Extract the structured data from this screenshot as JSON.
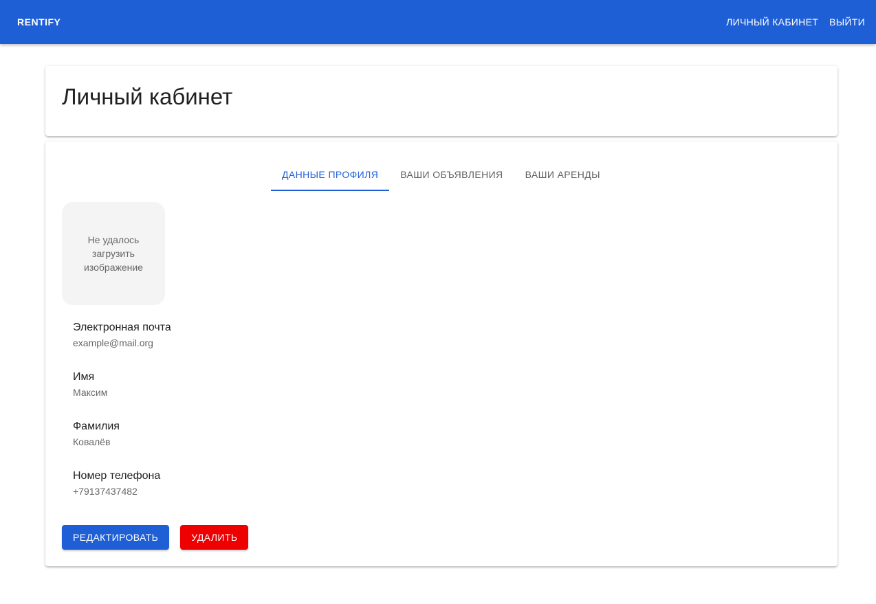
{
  "appbar": {
    "brand": "RENTIFY",
    "links": {
      "account": "ЛИЧНЫЙ КАБИНЕТ",
      "logout": "ВЫЙТИ"
    }
  },
  "page": {
    "title": "Личный кабинет"
  },
  "tabs": {
    "profile": "ДАННЫЕ ПРОФИЛЯ",
    "listings": "ВАШИ ОБЪЯВЛЕНИЯ",
    "rentals": "ВАШИ АРЕНДЫ",
    "active": "profile"
  },
  "avatar": {
    "error_text": "Не удалось загрузить изображение"
  },
  "profile": {
    "email": {
      "label": "Электронная почта",
      "value": "example@mail.org"
    },
    "first_name": {
      "label": "Имя",
      "value": "Максим"
    },
    "last_name": {
      "label": "Фамилия",
      "value": "Ковалёв"
    },
    "phone": {
      "label": "Номер телефона",
      "value": "+79137437482"
    }
  },
  "actions": {
    "edit": "РЕДАКТИРОВАТЬ",
    "delete": "УДАЛИТЬ"
  },
  "colors": {
    "primary": "#1f5fd6",
    "danger": "#ee0000"
  }
}
